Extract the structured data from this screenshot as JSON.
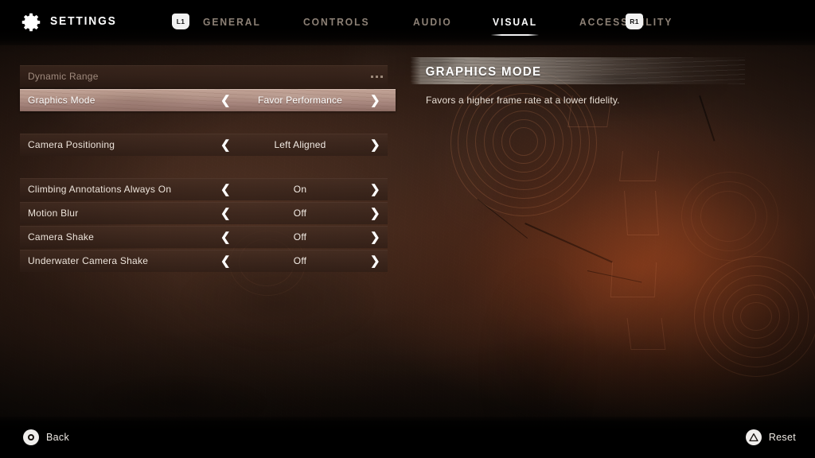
{
  "header": {
    "gear_icon": "gear-icon",
    "title": "SETTINGS",
    "left_bumper": "L1",
    "right_bumper": "R1",
    "tabs": [
      {
        "label": "GENERAL",
        "active": false
      },
      {
        "label": "CONTROLS",
        "active": false
      },
      {
        "label": "AUDIO",
        "active": false
      },
      {
        "label": "VISUAL",
        "active": true
      },
      {
        "label": "ACCESSIBILITY",
        "active": false
      }
    ]
  },
  "settings": {
    "groups": [
      {
        "rows": [
          {
            "label": "Dynamic Range",
            "value": "",
            "kind": "ellipsis",
            "selected": false,
            "disabled": true
          },
          {
            "label": "Graphics Mode",
            "value": "Favor Performance",
            "kind": "stepper",
            "selected": true,
            "disabled": false
          }
        ]
      },
      {
        "rows": [
          {
            "label": "Camera Positioning",
            "value": "Left Aligned",
            "kind": "stepper",
            "selected": false,
            "disabled": false
          }
        ]
      },
      {
        "rows": [
          {
            "label": "Climbing Annotations Always On",
            "value": "On",
            "kind": "stepper",
            "selected": false,
            "disabled": false
          },
          {
            "label": "Motion Blur",
            "value": "Off",
            "kind": "stepper",
            "selected": false,
            "disabled": false
          },
          {
            "label": "Camera Shake",
            "value": "Off",
            "kind": "stepper",
            "selected": false,
            "disabled": false
          },
          {
            "label": "Underwater Camera Shake",
            "value": "Off",
            "kind": "stepper",
            "selected": false,
            "disabled": false
          }
        ]
      }
    ],
    "arrow_left_icon": "chevron-left-icon",
    "arrow_right_icon": "chevron-right-icon"
  },
  "description": {
    "title": "GRAPHICS MODE",
    "body": "Favors a higher frame rate at a lower fidelity."
  },
  "footer": {
    "back": {
      "label": "Back",
      "icon": "playstation-circle-button-icon"
    },
    "reset": {
      "label": "Reset",
      "icon": "playstation-triangle-button-icon"
    }
  },
  "colors": {
    "accent_selected_row": "#b5968a",
    "text_primary": "#ffffff",
    "text_muted": "#8d8176",
    "background_brown": "#40271b",
    "panel_row": "#3a261d"
  }
}
